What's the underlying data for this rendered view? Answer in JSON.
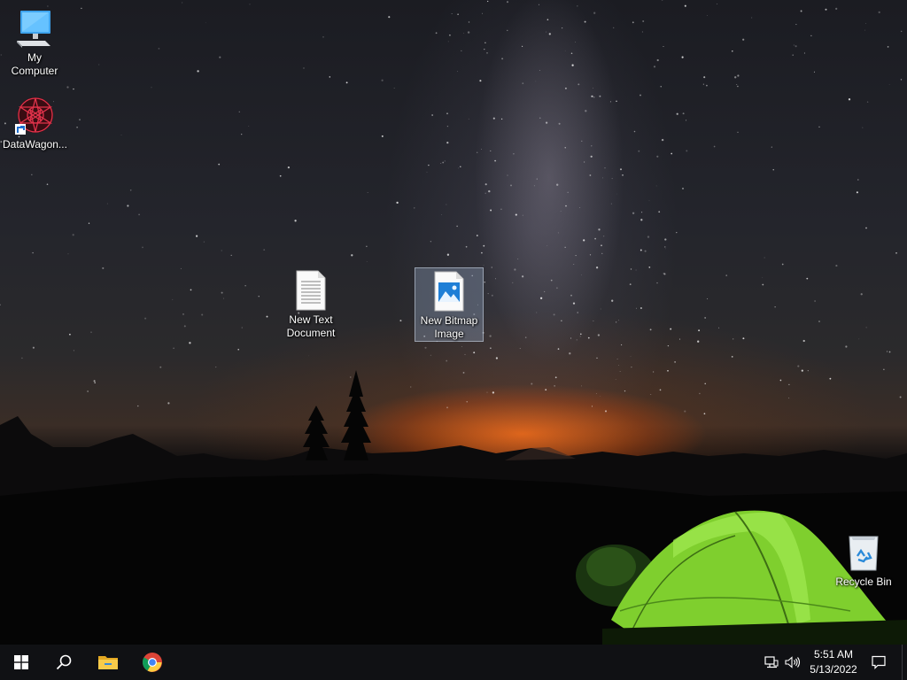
{
  "desktop": {
    "icons": [
      {
        "label": "My Computer",
        "icon": "computer-icon"
      },
      {
        "label": "DataWagon...",
        "icon": "datawagon-shortcut-icon"
      },
      {
        "label": "New Text Document",
        "icon": "text-document-icon"
      },
      {
        "label": "New Bitmap Image",
        "icon": "bitmap-image-icon",
        "selected": true
      },
      {
        "label": "Recycle Bin",
        "icon": "recycle-bin-icon"
      }
    ]
  },
  "taskbar": {
    "start": {
      "icon": "windows-start-icon"
    },
    "search": {
      "icon": "search-icon"
    },
    "pinned": [
      {
        "name": "File Explorer",
        "icon": "folder-icon"
      },
      {
        "name": "Google Chrome",
        "icon": "chrome-icon"
      }
    ],
    "tray": {
      "network_icon": "network-icon",
      "volume_icon": "volume-icon",
      "time": "5:51 AM",
      "date": "5/13/2022",
      "notifications_icon": "notification-icon"
    }
  },
  "colors": {
    "taskbar": "#101114",
    "selection": "#9fb4d2",
    "windows_blue": "#2a8ad9",
    "tent_green": "#8ee03a",
    "glow_orange": "#ff6e14"
  }
}
